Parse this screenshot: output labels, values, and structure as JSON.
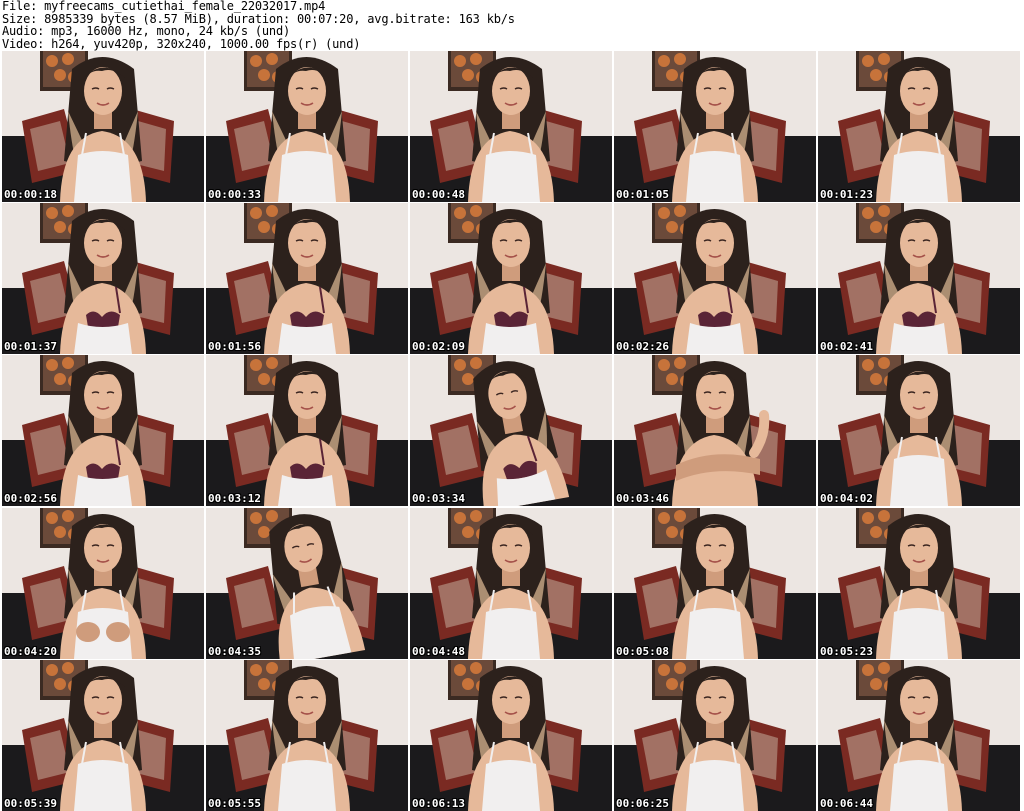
{
  "header": {
    "lines": [
      "File: myfreecams_cutiethai_female_22032017.mp4",
      "Size: 8985339 bytes (8.57 MiB), duration: 00:07:20, avg.bitrate: 163 kb/s",
      "Audio: mp3, 16000 Hz, mono, 24 kb/s (und)",
      "Video: h264, yuv420p, 320x240, 1000.00 fps(r) (und)"
    ]
  },
  "grid": {
    "columns": 5,
    "rows": 5
  },
  "thumbnails": [
    {
      "timestamp": "00:00:18",
      "pose": "center",
      "top": "white"
    },
    {
      "timestamp": "00:00:33",
      "pose": "center",
      "top": "white"
    },
    {
      "timestamp": "00:00:48",
      "pose": "center",
      "top": "white"
    },
    {
      "timestamp": "00:01:05",
      "pose": "center",
      "top": "white"
    },
    {
      "timestamp": "00:01:23",
      "pose": "center",
      "top": "white"
    },
    {
      "timestamp": "00:01:37",
      "pose": "center",
      "top": "white-lowered"
    },
    {
      "timestamp": "00:01:56",
      "pose": "center",
      "top": "white-lowered"
    },
    {
      "timestamp": "00:02:09",
      "pose": "center",
      "top": "white-lowered"
    },
    {
      "timestamp": "00:02:26",
      "pose": "center",
      "top": "white-lowered"
    },
    {
      "timestamp": "00:02:41",
      "pose": "center",
      "top": "white-lowered"
    },
    {
      "timestamp": "00:02:56",
      "pose": "center",
      "top": "white-lowered"
    },
    {
      "timestamp": "00:03:12",
      "pose": "center",
      "top": "white-lowered"
    },
    {
      "timestamp": "00:03:34",
      "pose": "tilted",
      "top": "white-lowered"
    },
    {
      "timestamp": "00:03:46",
      "pose": "arms-crossed",
      "top": "none"
    },
    {
      "timestamp": "00:04:02",
      "pose": "center",
      "top": "white"
    },
    {
      "timestamp": "00:04:20",
      "pose": "hands-up",
      "top": "white"
    },
    {
      "timestamp": "00:04:35",
      "pose": "tilted",
      "top": "white"
    },
    {
      "timestamp": "00:04:48",
      "pose": "center",
      "top": "white"
    },
    {
      "timestamp": "00:05:08",
      "pose": "center",
      "top": "white"
    },
    {
      "timestamp": "00:05:23",
      "pose": "center",
      "top": "white"
    },
    {
      "timestamp": "00:05:39",
      "pose": "center",
      "top": "white"
    },
    {
      "timestamp": "00:05:55",
      "pose": "center",
      "top": "white"
    },
    {
      "timestamp": "00:06:13",
      "pose": "center",
      "top": "white"
    },
    {
      "timestamp": "00:06:25",
      "pose": "center",
      "top": "white"
    },
    {
      "timestamp": "00:06:44",
      "pose": "center",
      "top": "white"
    }
  ],
  "colors": {
    "wall": "#ece6e2",
    "couch": "#1b1a1c",
    "cushion": "#7a2a22",
    "cushion_light": "#c9b7a6",
    "painting_frame": "#3b2a22",
    "painting_bg": "#6b4a3a",
    "painting_flower": "#d77a3b",
    "skin": "#e6b99a",
    "skin_shadow": "#cf9c7c",
    "hair_dark": "#2c211c",
    "hair_light": "#b99a7c",
    "top_white": "#f1efef",
    "bra_purple": "#5a2436",
    "timestamp_text": "#ffffff"
  }
}
